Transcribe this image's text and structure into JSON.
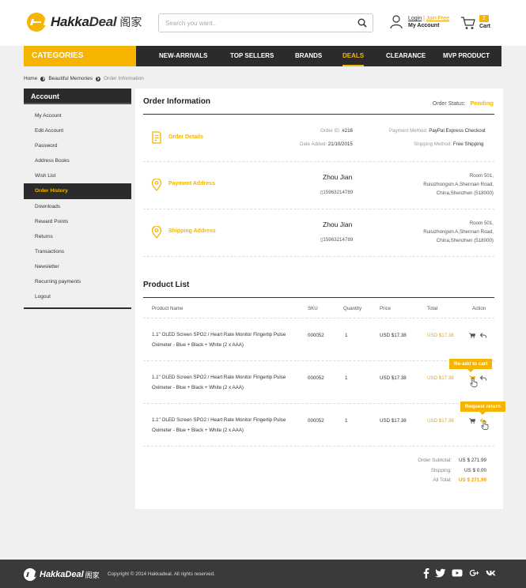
{
  "brand": {
    "name_a": "Hakka",
    "name_b": "Deal",
    "name_cn": "阁家"
  },
  "search": {
    "placeholder": "Search you want.."
  },
  "account": {
    "login": "Login",
    "sep": "|",
    "join": "Join Free",
    "my_account": "My Account"
  },
  "cart": {
    "count": "2",
    "label": "Cart"
  },
  "nav": {
    "categories": "CATEGORIES",
    "items": [
      {
        "label": "NEW-ARRIVALS"
      },
      {
        "label": "TOP SELLERS"
      },
      {
        "label": "BRANDS"
      },
      {
        "label": "DEALS",
        "active": true
      },
      {
        "label": "CLEARANCE"
      },
      {
        "label": "MVP PRODUCT"
      }
    ]
  },
  "breadcrumb": [
    "Home",
    "Beautiful Memories",
    "Order Information"
  ],
  "sidebar": {
    "title": "Account",
    "items": [
      {
        "label": "My Account"
      },
      {
        "label": "Edit Account"
      },
      {
        "label": "Password"
      },
      {
        "label": "Address Books"
      },
      {
        "label": "Wish List"
      },
      {
        "label": "Order History",
        "active": true
      },
      {
        "label": "Downloads"
      },
      {
        "label": "Reward Points"
      },
      {
        "label": "Returns"
      },
      {
        "label": "Transactions"
      },
      {
        "label": "Newsletter"
      },
      {
        "label": "Recurring payments"
      },
      {
        "label": "Logout"
      }
    ]
  },
  "order": {
    "title": "Order Information",
    "status_label": "Order Status:",
    "status": "Pending",
    "details": {
      "label": "Order Details",
      "order_id_k": "Order ID:",
      "order_id_v": "#216",
      "date_k": "Date Added:",
      "date_v": "21/10/2015",
      "payment_k": "Payment Method:",
      "payment_v": "PayPal Express Checkout",
      "shipping_k": "Shipping Method:",
      "shipping_v": "Free Shipping"
    },
    "payment_address": {
      "label": "Payment Address",
      "name": "Zhou Jian",
      "phone": "15963214789",
      "lines": [
        "Room 501,",
        "Ruisizhongxin A,Shennan Road,",
        "China,Shenzhen (518000)"
      ]
    },
    "shipping_address": {
      "label": "Shipping Address",
      "name": "Zhou Jian",
      "phone": "15963214789",
      "lines": [
        "Room 501,",
        "Ruisizhongxin A,Shennan Road,",
        "China,Shenzhen (518000)"
      ]
    }
  },
  "products": {
    "title": "Product List",
    "headers": {
      "name": "Product Name",
      "sku": "SKU",
      "qty": "Quantity",
      "price": "Price",
      "total": "Total",
      "action": "Action"
    },
    "rows": [
      {
        "name1": "1.1\" OLED Screen SPO2 / Heart Rate Monitor Fingertip Pulse",
        "name2": "Oximeter - Blue + Black + White (2 x AAA)",
        "sku": "000052",
        "qty": "1",
        "price": "USD $17.38",
        "total": "USD $17.38"
      },
      {
        "name1": "1.1\" OLED Screen SPO2 / Heart Rate Monitor Fingertip Pulse",
        "name2": "Oximeter - Blue + Black + White (2 x AAA)",
        "sku": "000052",
        "qty": "1",
        "price": "USD $17.38",
        "total": "USD $17.38"
      },
      {
        "name1": "1.1\" OLED Screen SPO2 / Heart Rate Monitor Fingertip Pulse",
        "name2": "Oximeter - Blue + Black + White (2 x AAA)",
        "sku": "000052",
        "qty": "1",
        "price": "USD $17.38",
        "total": "USD $17.38"
      }
    ],
    "tooltip_readd": "Re-add to cart",
    "tooltip_return": "Request return",
    "summary": {
      "subtotal_k": "Order Subtotal:",
      "subtotal_v": "US $ 271.99",
      "shipping_k": "Shipping:",
      "shipping_v": "US $ 0.00",
      "total_k": "All Total:",
      "total_v": "US $ 271.99"
    }
  },
  "footer": {
    "brand": "HakkaDeal",
    "brand_cn": "阁家",
    "copyright": "Copyright © 2014 Hakkadeal. All rights reserved."
  },
  "colors": {
    "accent": "#f5b400",
    "dark": "#2b2b2b",
    "price": "#f5a100"
  },
  "icons": [
    "search-icon",
    "user-icon",
    "cart-icon",
    "document-icon",
    "location-pin-icon",
    "cart-small-icon",
    "return-icon",
    "hand-pointer-icon",
    "facebook-icon",
    "twitter-icon",
    "youtube-icon",
    "google-plus-icon",
    "vk-icon"
  ]
}
